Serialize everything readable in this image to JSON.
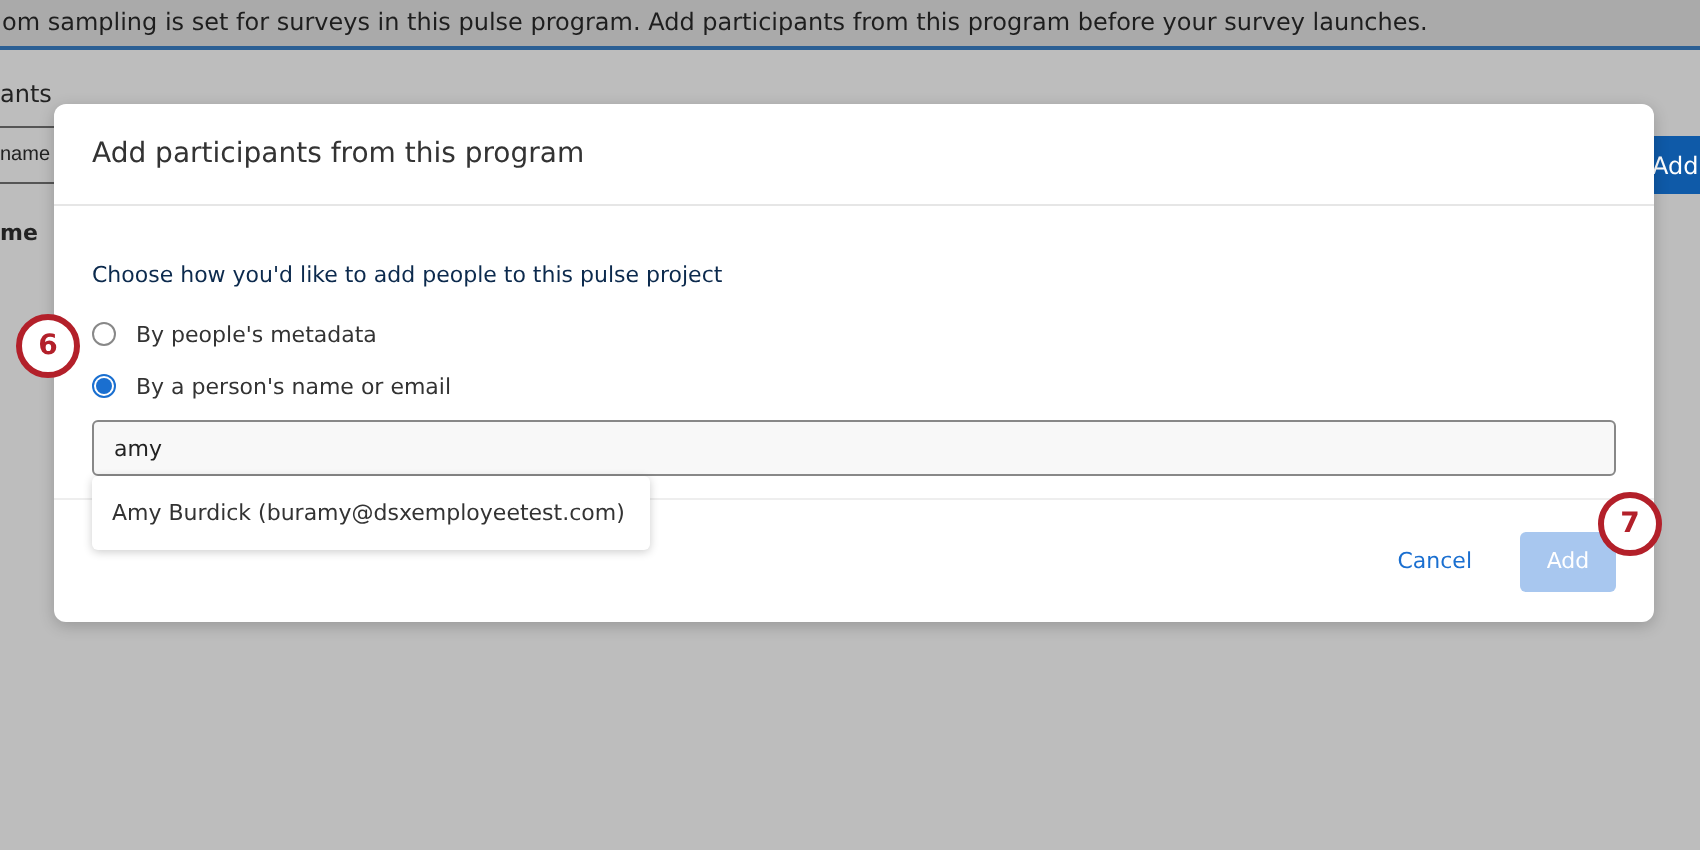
{
  "background": {
    "banner": "om sampling is set for surveys in this pulse program. Add participants from this program before your survey launches.",
    "section_label": "ants",
    "field_label": "name",
    "column_header": "me",
    "button": "Add"
  },
  "dialog": {
    "title": "Add participants from this program",
    "prompt": "Choose how you'd like to add people to this pulse project",
    "options": [
      {
        "label": "By people's metadata",
        "selected": false
      },
      {
        "label": "By a person's name or email",
        "selected": true
      }
    ],
    "search": {
      "value": "amy"
    },
    "suggestions": [
      "Amy Burdick (buramy@dsxemployeetest.com)"
    ],
    "cancel": "Cancel",
    "add": {
      "label": "Add",
      "disabled": true
    }
  },
  "callouts": [
    "6",
    "7"
  ]
}
